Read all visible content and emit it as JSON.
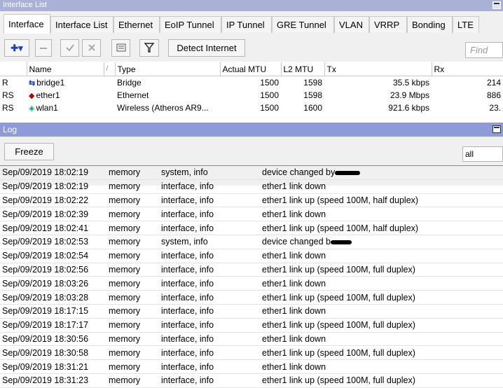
{
  "window_title": "Interface List",
  "tabs": [
    "Interface",
    "Interface List",
    "Ethernet",
    "EoIP Tunnel",
    "IP Tunnel",
    "GRE Tunnel",
    "VLAN",
    "VRRP",
    "Bonding",
    "LTE"
  ],
  "toolbar": {
    "add_glyph": "✚▾",
    "detect_label": "Detect Internet",
    "find_placeholder": "Find"
  },
  "icons": {
    "add": "plus-icon",
    "remove": "minus-icon",
    "enable": "check-icon",
    "disable": "cross-icon",
    "comment": "comment-icon",
    "filter": "filter-icon"
  },
  "interfaces": {
    "columns": [
      "",
      "Name",
      "/",
      "Type",
      "Actual MTU",
      "L2 MTU",
      "Tx",
      "Rx"
    ],
    "rows": [
      {
        "flags": "R",
        "name": "bridge1",
        "type": "Bridge",
        "actual_mtu": "1500",
        "l2_mtu": "1598",
        "tx": "35.5 kbps",
        "rx": "214"
      },
      {
        "flags": "RS",
        "name": "ether1",
        "type": "Ethernet",
        "actual_mtu": "1500",
        "l2_mtu": "1598",
        "tx": "23.9 Mbps",
        "rx": "886"
      },
      {
        "flags": "RS",
        "name": "wlan1",
        "type": "Wireless (Atheros AR9...",
        "actual_mtu": "1500",
        "l2_mtu": "1600",
        "tx": "921.6 kbps",
        "rx": "23."
      }
    ]
  },
  "log_panel": {
    "title": "Log",
    "freeze_label": "Freeze",
    "filter_value": "all",
    "entries": [
      {
        "time": "Sep/09/2019 18:02:19",
        "buffer": "memory",
        "topics": "system, info",
        "message": "device changed by"
      },
      {
        "time": "Sep/09/2019 18:02:19",
        "buffer": "memory",
        "topics": "interface, info",
        "message": "ether1 link down"
      },
      {
        "time": "Sep/09/2019 18:02:22",
        "buffer": "memory",
        "topics": "interface, info",
        "message": "ether1 link up (speed 100M, half duplex)"
      },
      {
        "time": "Sep/09/2019 18:02:39",
        "buffer": "memory",
        "topics": "interface, info",
        "message": "ether1 link down"
      },
      {
        "time": "Sep/09/2019 18:02:41",
        "buffer": "memory",
        "topics": "interface, info",
        "message": "ether1 link up (speed 100M, half duplex)"
      },
      {
        "time": "Sep/09/2019 18:02:53",
        "buffer": "memory",
        "topics": "system, info",
        "message": "device changed b"
      },
      {
        "time": "Sep/09/2019 18:02:54",
        "buffer": "memory",
        "topics": "interface, info",
        "message": "ether1 link down"
      },
      {
        "time": "Sep/09/2019 18:02:56",
        "buffer": "memory",
        "topics": "interface, info",
        "message": "ether1 link up (speed 100M, full duplex)"
      },
      {
        "time": "Sep/09/2019 18:03:26",
        "buffer": "memory",
        "topics": "interface, info",
        "message": "ether1 link down"
      },
      {
        "time": "Sep/09/2019 18:03:28",
        "buffer": "memory",
        "topics": "interface, info",
        "message": "ether1 link up (speed 100M, full duplex)"
      },
      {
        "time": "Sep/09/2019 18:17:15",
        "buffer": "memory",
        "topics": "interface, info",
        "message": "ether1 link down"
      },
      {
        "time": "Sep/09/2019 18:17:17",
        "buffer": "memory",
        "topics": "interface, info",
        "message": "ether1 link up (speed 100M, full duplex)"
      },
      {
        "time": "Sep/09/2019 18:30:56",
        "buffer": "memory",
        "topics": "interface, info",
        "message": "ether1 link down"
      },
      {
        "time": "Sep/09/2019 18:30:58",
        "buffer": "memory",
        "topics": "interface, info",
        "message": "ether1 link up (speed 100M, full duplex)"
      },
      {
        "time": "Sep/09/2019 18:31:21",
        "buffer": "memory",
        "topics": "interface, info",
        "message": "ether1 link down"
      },
      {
        "time": "Sep/09/2019 18:31:23",
        "buffer": "memory",
        "topics": "interface, info",
        "message": "ether1 link up (speed 100M, full duplex)"
      }
    ]
  },
  "colors": {
    "title_bar": "#a9b1d6",
    "log_title_bar": "#8f9bd8",
    "panel_bg": "#f0f0f0"
  }
}
